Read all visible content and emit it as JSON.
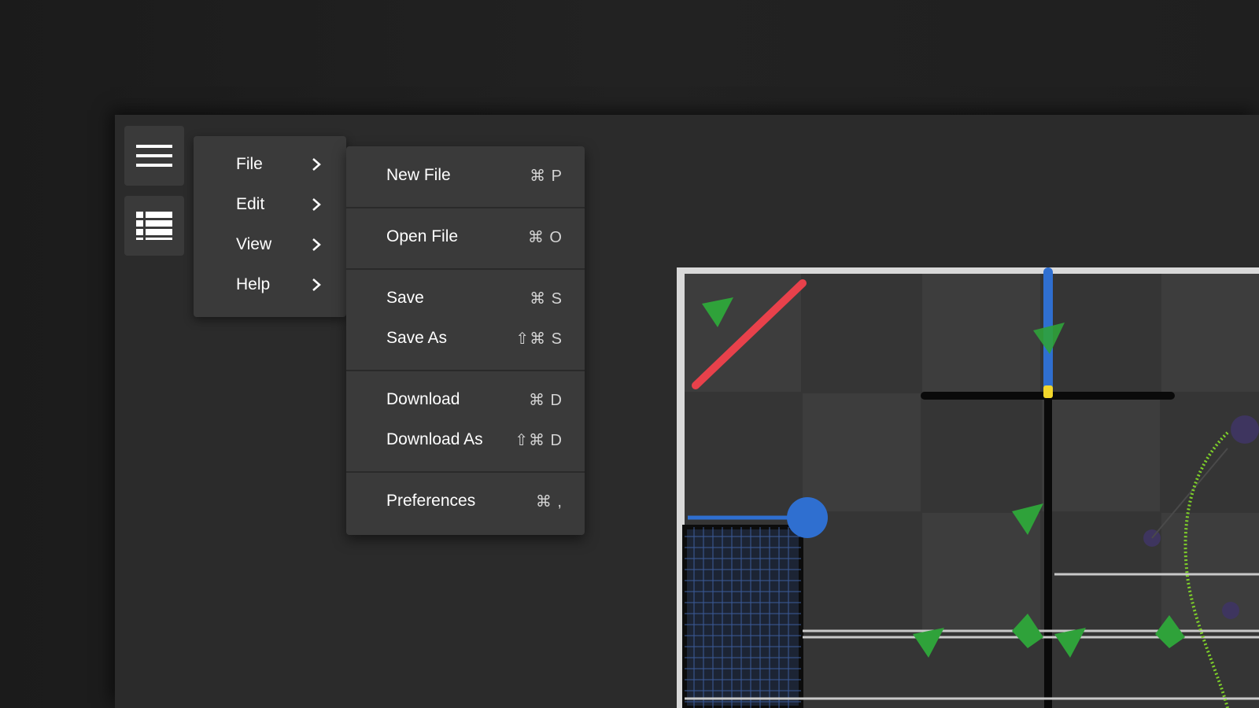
{
  "sidebar": {
    "buttons": [
      {
        "icon": "hamburger-menu-icon"
      },
      {
        "icon": "list-view-icon"
      }
    ]
  },
  "menu": {
    "primary": [
      {
        "label": "File",
        "has_submenu": true
      },
      {
        "label": "Edit",
        "has_submenu": true
      },
      {
        "label": "View",
        "has_submenu": true
      },
      {
        "label": "Help",
        "has_submenu": true
      }
    ],
    "file_submenu": {
      "new_file": {
        "label": "New File",
        "shortcut": "⌘ P"
      },
      "open_file": {
        "label": "Open File",
        "shortcut": "⌘ O"
      },
      "save": {
        "label": "Save",
        "shortcut": "⌘ S"
      },
      "save_as": {
        "label": "Save As",
        "shortcut": "⇧⌘ S"
      },
      "download": {
        "label": "Download",
        "shortcut": "⌘ D"
      },
      "download_as": {
        "label": "Download As",
        "shortcut": "⇧⌘ D"
      },
      "preferences": {
        "label": "Preferences",
        "shortcut": "⌘ ,"
      }
    }
  },
  "colors": {
    "window_bg": "#2b2b2b",
    "menu_bg": "#3a3a3a",
    "text": "#ffffff",
    "field_tile": "#3c3c3c",
    "field_wall": "#d9d9d9",
    "red_bar": "#e8414b",
    "blue_bar": "#2f6fd0",
    "green_object": "#2fa23a",
    "path": "#7fd12a"
  }
}
